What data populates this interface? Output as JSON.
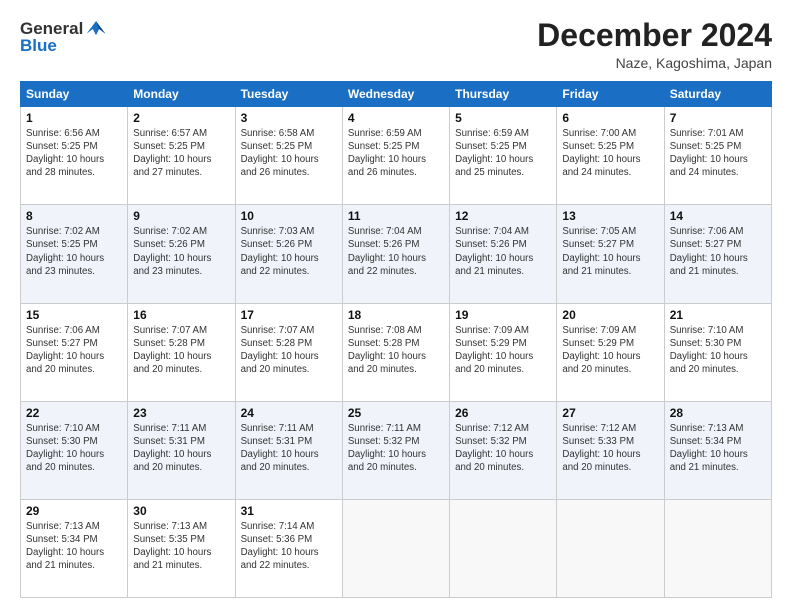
{
  "logo": {
    "general": "General",
    "blue": "Blue"
  },
  "header": {
    "month": "December 2024",
    "location": "Naze, Kagoshima, Japan"
  },
  "weekdays": [
    "Sunday",
    "Monday",
    "Tuesday",
    "Wednesday",
    "Thursday",
    "Friday",
    "Saturday"
  ],
  "weeks": [
    [
      {
        "day": "1",
        "info": "Sunrise: 6:56 AM\nSunset: 5:25 PM\nDaylight: 10 hours\nand 28 minutes."
      },
      {
        "day": "2",
        "info": "Sunrise: 6:57 AM\nSunset: 5:25 PM\nDaylight: 10 hours\nand 27 minutes."
      },
      {
        "day": "3",
        "info": "Sunrise: 6:58 AM\nSunset: 5:25 PM\nDaylight: 10 hours\nand 26 minutes."
      },
      {
        "day": "4",
        "info": "Sunrise: 6:59 AM\nSunset: 5:25 PM\nDaylight: 10 hours\nand 26 minutes."
      },
      {
        "day": "5",
        "info": "Sunrise: 6:59 AM\nSunset: 5:25 PM\nDaylight: 10 hours\nand 25 minutes."
      },
      {
        "day": "6",
        "info": "Sunrise: 7:00 AM\nSunset: 5:25 PM\nDaylight: 10 hours\nand 24 minutes."
      },
      {
        "day": "7",
        "info": "Sunrise: 7:01 AM\nSunset: 5:25 PM\nDaylight: 10 hours\nand 24 minutes."
      }
    ],
    [
      {
        "day": "8",
        "info": "Sunrise: 7:02 AM\nSunset: 5:25 PM\nDaylight: 10 hours\nand 23 minutes."
      },
      {
        "day": "9",
        "info": "Sunrise: 7:02 AM\nSunset: 5:26 PM\nDaylight: 10 hours\nand 23 minutes."
      },
      {
        "day": "10",
        "info": "Sunrise: 7:03 AM\nSunset: 5:26 PM\nDaylight: 10 hours\nand 22 minutes."
      },
      {
        "day": "11",
        "info": "Sunrise: 7:04 AM\nSunset: 5:26 PM\nDaylight: 10 hours\nand 22 minutes."
      },
      {
        "day": "12",
        "info": "Sunrise: 7:04 AM\nSunset: 5:26 PM\nDaylight: 10 hours\nand 21 minutes."
      },
      {
        "day": "13",
        "info": "Sunrise: 7:05 AM\nSunset: 5:27 PM\nDaylight: 10 hours\nand 21 minutes."
      },
      {
        "day": "14",
        "info": "Sunrise: 7:06 AM\nSunset: 5:27 PM\nDaylight: 10 hours\nand 21 minutes."
      }
    ],
    [
      {
        "day": "15",
        "info": "Sunrise: 7:06 AM\nSunset: 5:27 PM\nDaylight: 10 hours\nand 20 minutes."
      },
      {
        "day": "16",
        "info": "Sunrise: 7:07 AM\nSunset: 5:28 PM\nDaylight: 10 hours\nand 20 minutes."
      },
      {
        "day": "17",
        "info": "Sunrise: 7:07 AM\nSunset: 5:28 PM\nDaylight: 10 hours\nand 20 minutes."
      },
      {
        "day": "18",
        "info": "Sunrise: 7:08 AM\nSunset: 5:28 PM\nDaylight: 10 hours\nand 20 minutes."
      },
      {
        "day": "19",
        "info": "Sunrise: 7:09 AM\nSunset: 5:29 PM\nDaylight: 10 hours\nand 20 minutes."
      },
      {
        "day": "20",
        "info": "Sunrise: 7:09 AM\nSunset: 5:29 PM\nDaylight: 10 hours\nand 20 minutes."
      },
      {
        "day": "21",
        "info": "Sunrise: 7:10 AM\nSunset: 5:30 PM\nDaylight: 10 hours\nand 20 minutes."
      }
    ],
    [
      {
        "day": "22",
        "info": "Sunrise: 7:10 AM\nSunset: 5:30 PM\nDaylight: 10 hours\nand 20 minutes."
      },
      {
        "day": "23",
        "info": "Sunrise: 7:11 AM\nSunset: 5:31 PM\nDaylight: 10 hours\nand 20 minutes."
      },
      {
        "day": "24",
        "info": "Sunrise: 7:11 AM\nSunset: 5:31 PM\nDaylight: 10 hours\nand 20 minutes."
      },
      {
        "day": "25",
        "info": "Sunrise: 7:11 AM\nSunset: 5:32 PM\nDaylight: 10 hours\nand 20 minutes."
      },
      {
        "day": "26",
        "info": "Sunrise: 7:12 AM\nSunset: 5:32 PM\nDaylight: 10 hours\nand 20 minutes."
      },
      {
        "day": "27",
        "info": "Sunrise: 7:12 AM\nSunset: 5:33 PM\nDaylight: 10 hours\nand 20 minutes."
      },
      {
        "day": "28",
        "info": "Sunrise: 7:13 AM\nSunset: 5:34 PM\nDaylight: 10 hours\nand 21 minutes."
      }
    ],
    [
      {
        "day": "29",
        "info": "Sunrise: 7:13 AM\nSunset: 5:34 PM\nDaylight: 10 hours\nand 21 minutes."
      },
      {
        "day": "30",
        "info": "Sunrise: 7:13 AM\nSunset: 5:35 PM\nDaylight: 10 hours\nand 21 minutes."
      },
      {
        "day": "31",
        "info": "Sunrise: 7:14 AM\nSunset: 5:36 PM\nDaylight: 10 hours\nand 22 minutes."
      },
      {
        "day": "",
        "info": ""
      },
      {
        "day": "",
        "info": ""
      },
      {
        "day": "",
        "info": ""
      },
      {
        "day": "",
        "info": ""
      }
    ]
  ]
}
